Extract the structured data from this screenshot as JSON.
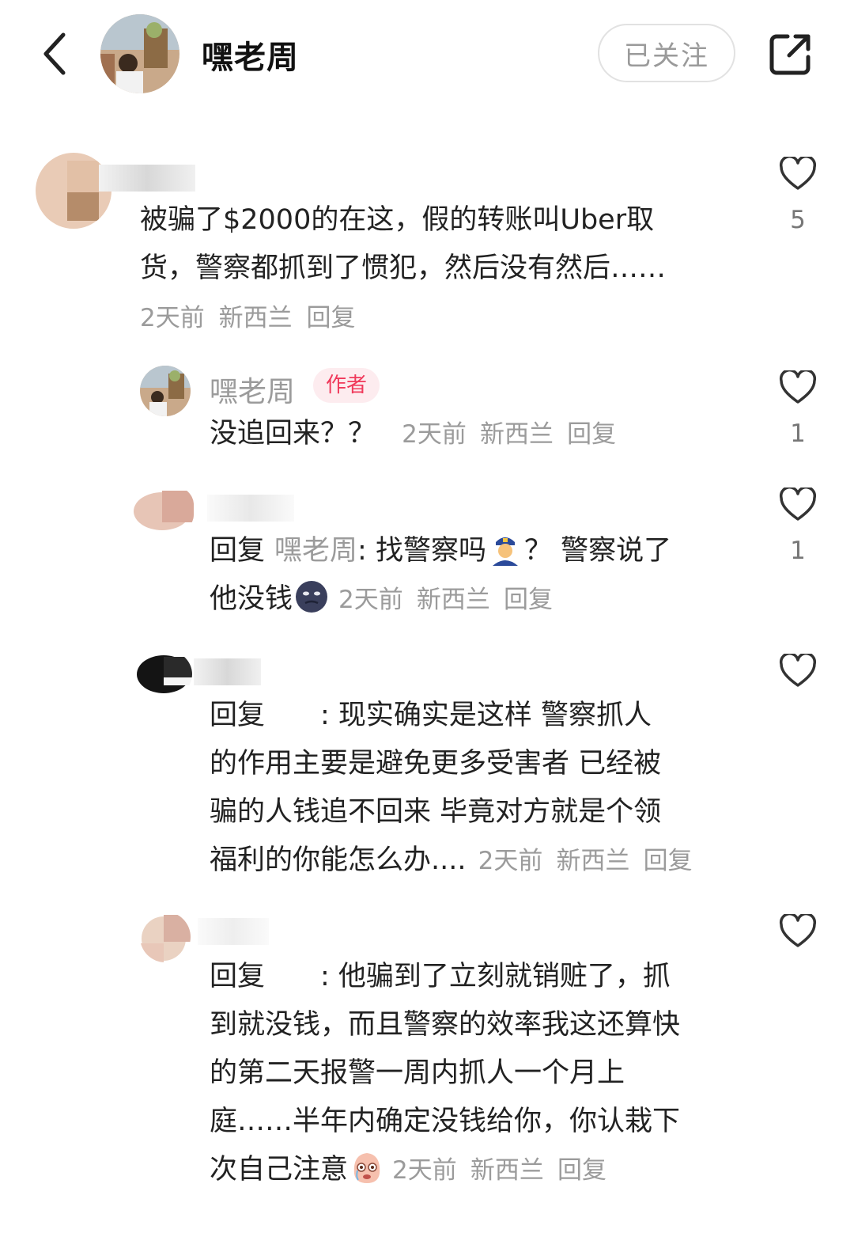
{
  "header": {
    "title": "嘿老周",
    "follow_label": "已关注"
  },
  "comments": [
    {
      "text_line1": "被骗了$2000的在这，假的转账叫Uber取",
      "text_line2": "货，警察都抓到了惯犯，然后没有然后……",
      "time": "2天前",
      "location": "新西兰",
      "reply_label": "回复",
      "likes": "5"
    }
  ],
  "replies": [
    {
      "author": "嘿老周",
      "author_tag": "作者",
      "text": "没追回来？？",
      "time": "2天前",
      "location": "新西兰",
      "reply_label": "回复",
      "likes": "1"
    },
    {
      "prefix": "回复",
      "mention": "嘿老周",
      "text_a": ": 找警察吗",
      "text_b": "？ 警察说了",
      "text_c": "他没钱",
      "time": "2天前",
      "location": "新西兰",
      "reply_label": "回复",
      "likes": "1",
      "emoji1": "police-officer-emoji",
      "emoji2": "dark-moon-face-emoji"
    },
    {
      "prefix": "回复",
      "line1": ": 现实确实是这样 警察抓人",
      "line2": "的作用主要是避免更多受害者 已经被",
      "line3": "骗的人钱追不回来 毕竟对方就是个领",
      "line4": "福利的你能怎么办....",
      "time": "2天前",
      "location": "新西兰",
      "reply_label": "回复"
    },
    {
      "prefix": "回复",
      "line1": ": 他骗到了立刻就销赃了，抓",
      "line2": "到就没钱，而且警察的效率我这还算快",
      "line3": "的第二天报警一周内抓人一个月上",
      "line4": "庭……半年内确定没钱给你，你认栽下",
      "line5": "次自己注意",
      "time": "2天前",
      "location": "新西兰",
      "reply_label": "回复",
      "emoji": "crying-face-emoji"
    }
  ],
  "icons": {
    "back": "chevron-left-icon",
    "share": "share-icon",
    "like": "heart-outline-icon"
  }
}
